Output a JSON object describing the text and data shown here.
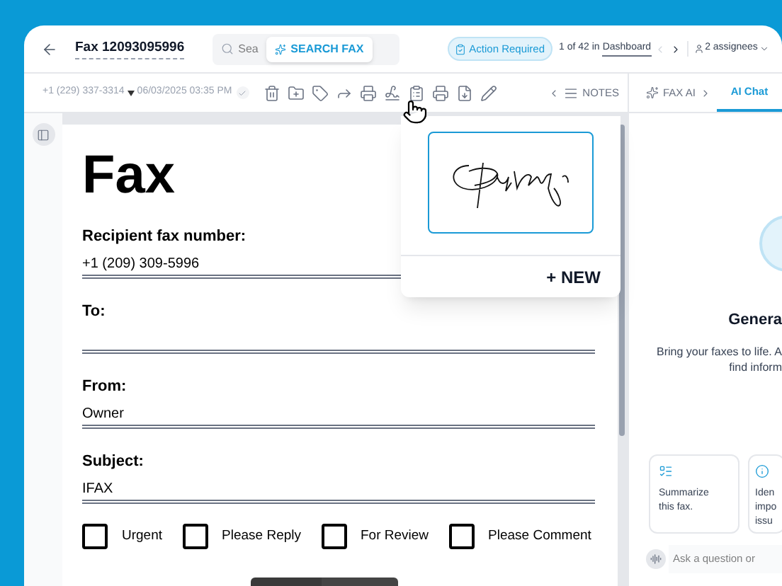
{
  "header": {
    "title": "Fax 12093095996",
    "search": {
      "placeholder": "Sea"
    },
    "search_button": "SEARCH FAX",
    "status_badge": "Action Required",
    "position": "1 of 42 in",
    "position_link": "Dashboard",
    "assignees": "2 assignees"
  },
  "toolbar": {
    "sender": "+1 (229) 337-3314",
    "date": "06/03/2025 03:35 PM",
    "notes": "NOTES"
  },
  "signature_menu": {
    "new_button": "+ NEW"
  },
  "document": {
    "title": "Fax",
    "fields": [
      {
        "label": "Recipient fax number:",
        "value": "+1 (209) 309-5996"
      },
      {
        "label": "To:"
      },
      {
        "label": "From:",
        "value": "Owner"
      },
      {
        "label": "Subject:",
        "value": "IFAX"
      }
    ],
    "checkboxes": [
      {
        "label": "Urgent",
        "checked": false
      },
      {
        "label": "Please Reply",
        "checked": false
      },
      {
        "label": "For Review",
        "checked": false
      },
      {
        "label": "Please Comment",
        "checked": false
      }
    ]
  },
  "ai_panel": {
    "tabs": [
      {
        "label": "FAX AI",
        "selected": false
      },
      {
        "label": "AI Chat",
        "selected": true
      }
    ],
    "heading": "Genera",
    "description": [
      "Bring your faxes to life. A",
      "find inform"
    ],
    "suggestions": [
      {
        "kind": "summarize",
        "lines": [
          "Summarize",
          "this fax."
        ]
      },
      {
        "kind": "identify",
        "lines": [
          "Iden",
          "impo",
          "issu"
        ]
      }
    ],
    "input": {
      "placeholder": "Ask a question or"
    }
  }
}
